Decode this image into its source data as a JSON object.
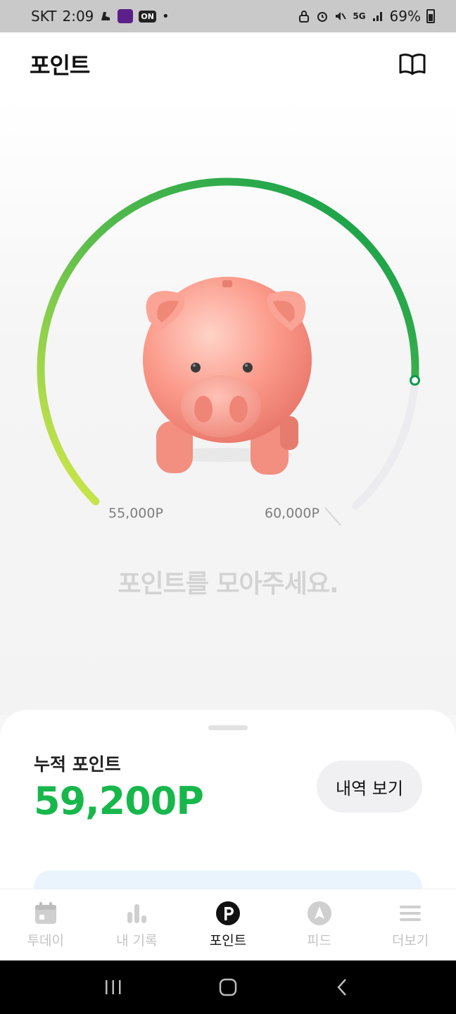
{
  "status_bar": {
    "carrier": "SKT",
    "time": "2:09",
    "network": "5G",
    "battery": "69%"
  },
  "header": {
    "title": "포인트",
    "guide_icon": "book-icon"
  },
  "gauge": {
    "current_points": 59200,
    "min_points": 55000,
    "max_points": 60000,
    "min_label": "55,000P",
    "max_label": "60,000P",
    "fill_fraction": 0.84,
    "gradient_start": "#d9ea4a",
    "gradient_end": "#069a4a",
    "track_color": "#ececf0",
    "illustration": "piggy-bank"
  },
  "hint": "포인트를 모아주세요.",
  "summary": {
    "label": "누적 포인트",
    "value": "59,200P",
    "history_button": "내역 보기",
    "accent": "#18b74b"
  },
  "tabs": [
    {
      "id": "today",
      "label": "투데이",
      "icon": "calendar-icon",
      "active": false
    },
    {
      "id": "records",
      "label": "내 기록",
      "icon": "bar-chart-icon",
      "active": false
    },
    {
      "id": "points",
      "label": "포인트",
      "icon": "point-icon",
      "active": true
    },
    {
      "id": "feed",
      "label": "피드",
      "icon": "compass-icon",
      "active": false
    },
    {
      "id": "more",
      "label": "더보기",
      "icon": "menu-icon",
      "active": false
    }
  ]
}
